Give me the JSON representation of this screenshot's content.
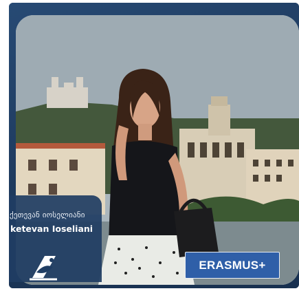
{
  "person": {
    "name_ka": "ქეთევან იოსელიანი",
    "name_en": "ketevan Ioseliani"
  },
  "badge": {
    "program": "ERASMUS+"
  },
  "logo": {
    "icon": "university-logo-icon"
  },
  "colors": {
    "navy_frame": "#1f3d63",
    "badge_blue": "#2f5fa8",
    "text_light": "#ffffff"
  }
}
